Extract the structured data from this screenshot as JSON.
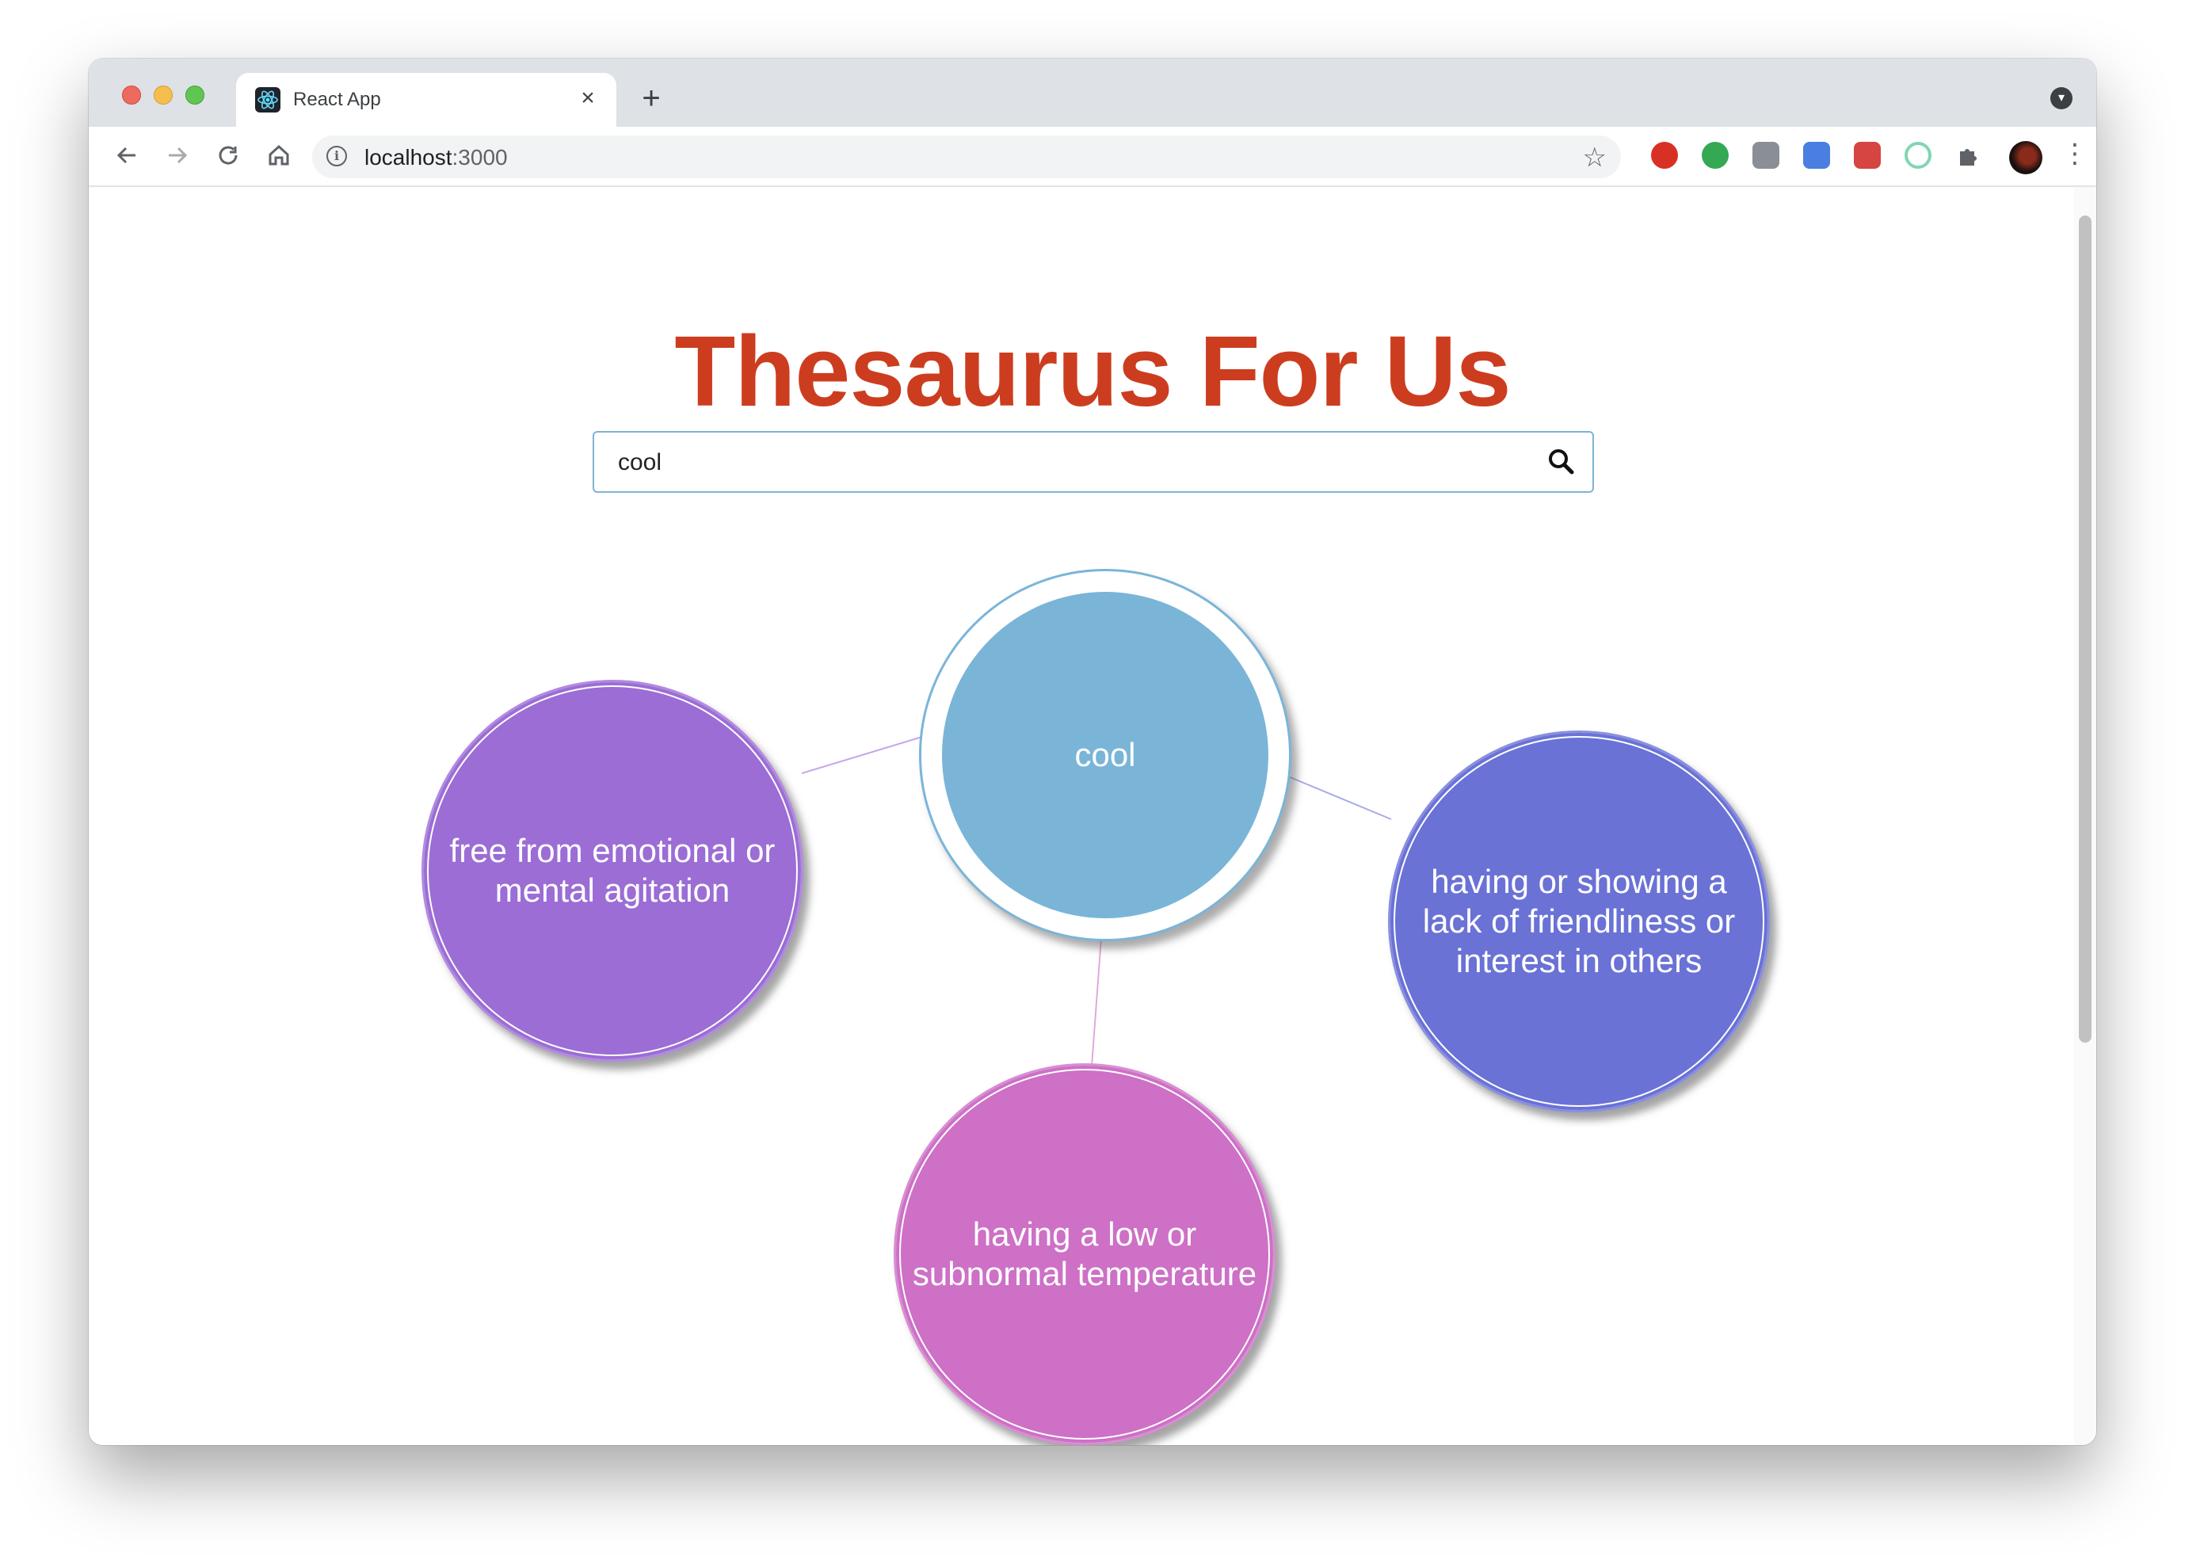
{
  "browser": {
    "tab_title": "React App",
    "tab_close": "×",
    "new_tab": "+",
    "url_host": "localhost",
    "url_port": ":3000",
    "icons": [
      "back-arrow-icon",
      "forward-arrow-icon",
      "reload-icon",
      "home-icon",
      "info-icon",
      "star-icon",
      "puzzle-icon",
      "menu-dots-icon"
    ],
    "extensions": [
      "adblock-extension-icon",
      "green-chat-extension-icon",
      "gray-extension-icon",
      "blue-extension-icon",
      "red-extension-icon",
      "green-ring-extension-icon"
    ]
  },
  "app": {
    "title": "Thesaurus For Us",
    "search": {
      "value": "cool",
      "icon": "search-icon"
    },
    "colors": {
      "title": "#cc3d1f",
      "center_node": "#7ab5d8",
      "node_1": "#9b6dd5",
      "node_2": "#6a72d6",
      "node_3": "#cd70c6"
    },
    "graph": {
      "center": "cool",
      "nodes": [
        "free from emotional or mental agitation",
        "having or showing a lack of friendliness or interest in others",
        "having a low or subnormal temperature"
      ]
    }
  }
}
